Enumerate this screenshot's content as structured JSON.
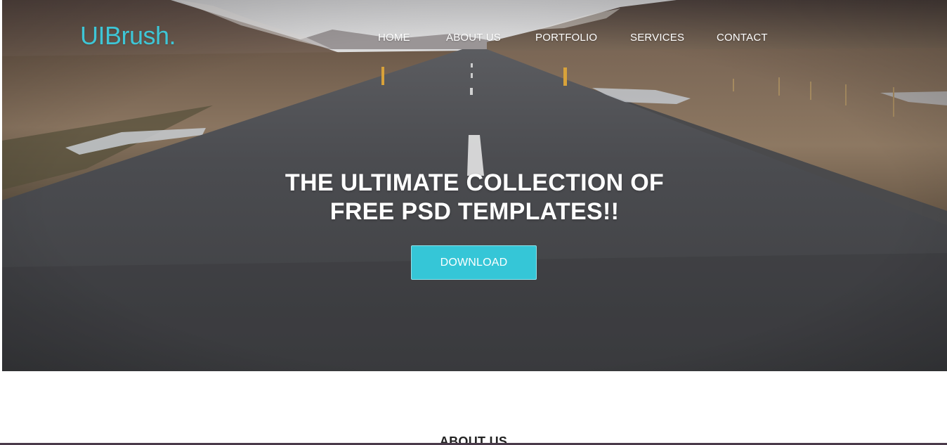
{
  "brand": {
    "name": "UIBrush",
    "dot": ".",
    "color": "#3ec6d6"
  },
  "nav": {
    "items": [
      {
        "label": "HOME"
      },
      {
        "label": "ABOUT US"
      },
      {
        "label": "PORTFOLIO"
      },
      {
        "label": "SERVICES"
      },
      {
        "label": "CONTACT"
      }
    ]
  },
  "hero": {
    "headline_line1": "THE ULTIMATE COLLECTION OF",
    "headline_line2": "FREE PSD TEMPLATES!!",
    "cta_label": "DOWNLOAD",
    "cta_color": "#35c6d7"
  },
  "about": {
    "title": "ABOUT US"
  }
}
